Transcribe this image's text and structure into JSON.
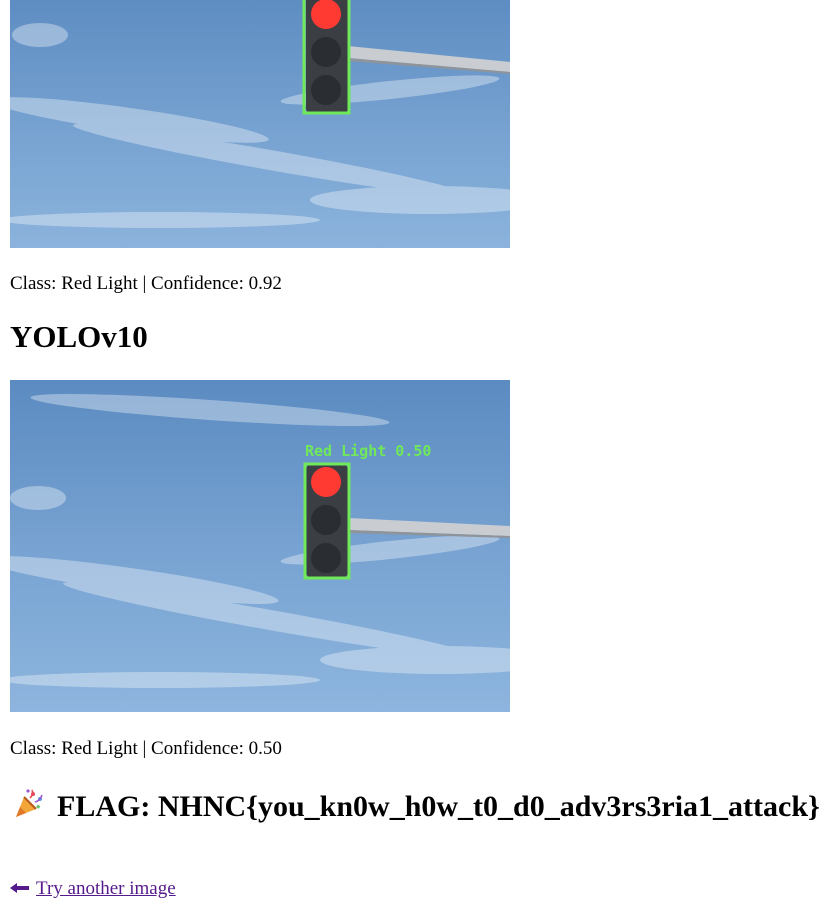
{
  "results": [
    {
      "model": "",
      "detection_label": "",
      "caption": "Class: Red Light | Confidence: 0.92"
    },
    {
      "model": "YOLOv10",
      "detection_label": "Red Light 0.50",
      "caption": "Class: Red Light | Confidence: 0.50"
    }
  ],
  "flag": {
    "icon": "party-popper-icon",
    "text": "FLAG: NHNC{you_kn0w_h0w_t0_d0_adv3rs3ria1_attack}"
  },
  "back_link": {
    "icon": "left-arrow-icon",
    "label": "Try another image"
  },
  "colors": {
    "detection_box": "#6fe85a",
    "link": "#551a8b",
    "sky": "#5f8fc4",
    "red_light": "#ff3a33"
  }
}
